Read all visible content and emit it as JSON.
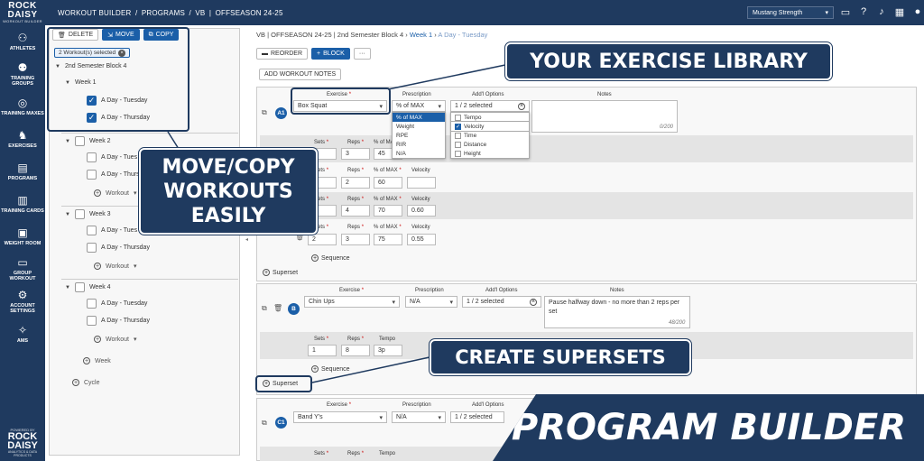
{
  "app": {
    "logo_line1": "ROCK",
    "logo_line2": "DAISY",
    "logo_sub": "WORKOUT BUILDER"
  },
  "breadcrumb": {
    "a": "WORKOUT BUILDER",
    "b": "PROGRAMS",
    "c": "VB",
    "d": "OFFSEASON 24-25"
  },
  "org_select": "Mustang Strength",
  "nav": [
    {
      "label": "ATHLETES",
      "icon": "athletes-icon"
    },
    {
      "label": "TRAINING GROUPS",
      "icon": "groups-icon"
    },
    {
      "label": "TRAINING MAXES",
      "icon": "maxes-icon"
    },
    {
      "label": "EXERCISES",
      "icon": "exercises-icon"
    },
    {
      "label": "PROGRAMS",
      "icon": "programs-icon"
    },
    {
      "label": "TRAINING CARDS",
      "icon": "cards-icon"
    },
    {
      "label": "WEIGHT ROOM",
      "icon": "weight-room-icon"
    },
    {
      "label": "GROUP WORKOUT",
      "icon": "group-workout-icon"
    },
    {
      "label": "ACCOUNT SETTINGS",
      "icon": "account-icon"
    },
    {
      "label": "AMS",
      "icon": "ams-icon"
    }
  ],
  "nav_foot": {
    "t1": "POWERED BY",
    "t2a": "ROCK",
    "t2b": "DAISY",
    "t3": "ANALYTICS & DATA PRODUCTS"
  },
  "tree": {
    "delete": "DELETE",
    "move": "MOVE",
    "copy": "COPY",
    "selected_chip": "2 Workout(s) selected",
    "block": "2nd Semester Block 4",
    "week1": "Week 1",
    "w1a": "A Day - Tuesday",
    "w1b": "A Day - Thursday",
    "week2": "Week 2",
    "w2a": "A Day - Tues",
    "w2b": "A Day - Thurs",
    "w2wo": "Workout",
    "week3": "Week 3",
    "w3a": "A Day - Tues",
    "w3b": "A Day - Thursday",
    "w3wo": "Workout",
    "week4": "Week 4",
    "w4a": "A Day - Tuesday",
    "w4b": "A Day - Thursday",
    "w4wo": "Workout",
    "add_week": "Week",
    "add_cycle": "Cycle"
  },
  "main": {
    "crumb_prog": "VB | OFFSEASON 24-25",
    "crumb_block": "2nd Semester Block 4",
    "crumb_week": "Week 1",
    "crumb_day": "A Day - Tuesday",
    "reorder": "REORDER",
    "block_btn": "BLOCK",
    "more": "···",
    "add_workout": "ADD WORKOUT NOTES",
    "hdr_exercise": "Exercise",
    "hdr_prescription": "Prescription",
    "hdr_options": "Add'l Options",
    "hdr_notes": "Notes",
    "a1": {
      "badge": "A1",
      "exercise": "Box Squat",
      "prescription": "% of MAX",
      "options": "1 / 2 selected",
      "notes_count": "0/200",
      "rx_menu": [
        "% of MAX",
        "Weight",
        "RPE",
        "RIR",
        "N/A"
      ],
      "opt_menu": [
        {
          "label": "Tempo",
          "checked": false
        },
        {
          "label": "Velocity",
          "checked": true
        },
        {
          "label": "Time",
          "checked": false
        },
        {
          "label": "Distance",
          "checked": false
        },
        {
          "label": "Height",
          "checked": false
        }
      ],
      "set_headers": [
        "Sets",
        "Reps",
        "% of MAX",
        "Velocity"
      ],
      "sets": [
        {
          "sets": "1",
          "reps": "3",
          "pct": "45",
          "vel": ""
        },
        {
          "sets": "1",
          "reps": "2",
          "pct": "60",
          "vel": ""
        },
        {
          "sets": "2",
          "reps": "4",
          "pct": "70",
          "vel": "0.60"
        },
        {
          "sets": "2",
          "reps": "3",
          "pct": "75",
          "vel": "0.55"
        }
      ],
      "sequence": "Sequence",
      "superset": "Superset"
    },
    "b": {
      "badge": "B",
      "exercise": "Chin Ups",
      "prescription": "N/A",
      "options": "1 / 2 selected",
      "notes": "Pause halfway down - no more than 2 reps per set",
      "notes_count": "48/200",
      "set_headers": [
        "Sets",
        "Reps",
        "Tempo"
      ],
      "sets": [
        {
          "sets": "1",
          "reps": "8",
          "tempo": "3p"
        }
      ],
      "sequence": "Sequence",
      "superset": "Superset"
    },
    "c1": {
      "badge": "C1",
      "exercise": "Band Y's",
      "prescription": "N/A",
      "options": "1 / 2 selected",
      "set_headers": [
        "Sets",
        "Reps",
        "Tempo"
      ]
    }
  },
  "callouts": {
    "library": "YOUR EXERCISE LIBRARY",
    "move_copy": "MOVE/COPY WORKOUTS EASILY",
    "supersets": "CREATE SUPERSETS",
    "banner": "PROGRAM BUILDER"
  },
  "colors": {
    "navy": "#1f3a5f",
    "accent": "#1b5fa8"
  }
}
